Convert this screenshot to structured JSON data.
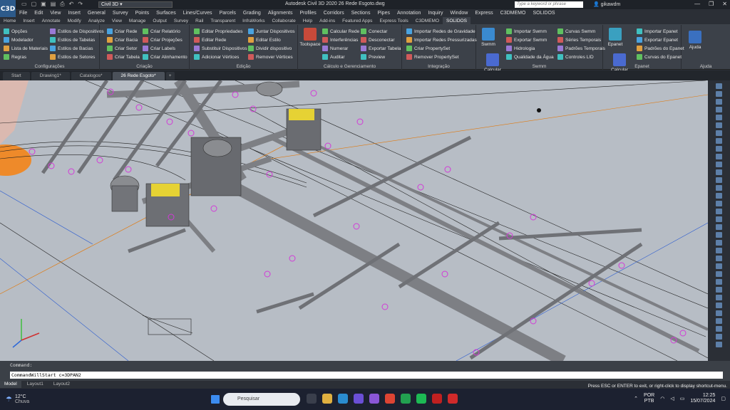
{
  "app": {
    "badge": "C3D",
    "title": "Autodesk Civil 3D 2020   26 Rede Esgoto.dwg",
    "workspace": "Civil 3D",
    "search_placeholder": "Type a keyword or phrase",
    "user": "gikawdm"
  },
  "menubar": [
    "File",
    "Edit",
    "View",
    "Insert",
    "General",
    "Survey",
    "Points",
    "Surfaces",
    "Lines/Curves",
    "Parcels",
    "Grading",
    "Alignments",
    "Profiles",
    "Corridors",
    "Sections",
    "Pipes",
    "Annotation",
    "Inquiry",
    "Window",
    "Express",
    "C3DMEMO",
    "SOLIDOS"
  ],
  "ribbon_tabs": [
    "Home",
    "Insert",
    "Annotate",
    "Modify",
    "Analyze",
    "View",
    "Manage",
    "Output",
    "Survey",
    "Rail",
    "Transparent",
    "InfraWorks",
    "Collaborate",
    "Help",
    "Add-ins",
    "Featured Apps",
    "Express Tools",
    "C3DMEMO",
    "SOLIDOS"
  ],
  "ribbon_active": "SOLIDOS",
  "panels": {
    "config": {
      "title": "Configurações",
      "items": [
        "Opções",
        "Modelador",
        "Lista de Materiais",
        "Regras"
      ],
      "items2": [
        "Estilos de Dispositivos",
        "Estilos de Tabelas",
        "Estilos de Bacias",
        "Estilos de Setores"
      ]
    },
    "criacao": {
      "title": "Criação",
      "items": [
        "Criar Rede",
        "Criar Bacia",
        "Criar Setor",
        "Criar Tabela"
      ],
      "items2": [
        "Criar Relatório",
        "Criar Projeções",
        "Criar Labels",
        "Criar Alinhamento"
      ]
    },
    "edicao": {
      "title": "Edição",
      "items": [
        "Editar Propriedades",
        "Editar Rede",
        "Substituir Dispositivos",
        "Adicionar Vértices"
      ],
      "items2": [
        "Juntar Dispositivos",
        "Editar Estilo",
        "Dividir dispositivo",
        "Remover Vértices"
      ]
    },
    "calculo": {
      "title": "Cálculo e Gerenciamento",
      "toolspace": "Toolspace",
      "items": [
        "Calcular Rede",
        "Interferências",
        "Numerar",
        "Auditar"
      ],
      "items2": [
        "Conectar",
        "Desconectar",
        "Exportar Tabela",
        "Preview"
      ]
    },
    "integracao": {
      "title": "Integração",
      "items": [
        "Importar Redes de Gravidade",
        "Importar Redes Pressurizadas",
        "Criar PropertySet",
        "Remover PropertySet"
      ]
    },
    "swmm": {
      "title": "Swmm",
      "big1": "Swmm",
      "big2": "Calcular",
      "items": [
        "Importar Swmm",
        "Exportar Swmm",
        "Hidrologia",
        "Qualidade da Água"
      ],
      "items2": [
        "Curvas Swmm",
        "Séries Temporais",
        "Padrões Temporais",
        "Controles LID"
      ]
    },
    "epanet": {
      "title": "Epanet",
      "big1": "Epanet",
      "big2": "Calcular",
      "items": [
        "Importar Epanet",
        "Exportar Epanet",
        "Padrões do Epanet",
        "Curvas do Epanet"
      ]
    },
    "ajuda": {
      "title": "Ajuda",
      "big": "Ajuda"
    }
  },
  "doc_tabs": [
    "Start",
    "Drawing1*",
    "Catalogos*",
    "26 Rede Esgoto*"
  ],
  "doc_active": "26 Rede Esgoto*",
  "command": {
    "label": "Command:",
    "input": "CommandWillStart c=3DPAN2"
  },
  "layout_tabs": [
    "Model",
    "Layout1",
    "Layout2"
  ],
  "status_hint": "Press ESC or ENTER to exit, or right-click to display shortcut-menu.",
  "taskbar": {
    "temp": "12°C",
    "weather": "Chuva",
    "search": "Pesquisar",
    "lang1": "POR",
    "lang2": "PTB",
    "time": "12:25",
    "date": "15/07/2024"
  }
}
